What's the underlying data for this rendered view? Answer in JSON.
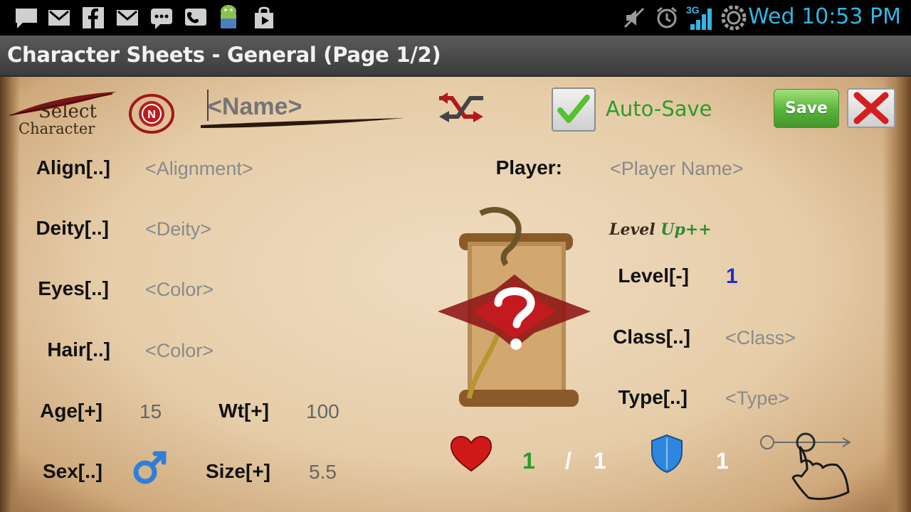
{
  "status_bar": {
    "time": "Wed 10:53 PM",
    "network": "3G",
    "left_icons": [
      "message-icon",
      "gmail-icon",
      "facebook-icon",
      "gmail-icon",
      "chat-icon",
      "voicemail-icon",
      "android-icon",
      "play-store-icon"
    ],
    "right_icons": [
      "mute-icon",
      "alarm-icon",
      "signal-icon",
      "sync-icon"
    ]
  },
  "app": {
    "title": "Character Sheets - General (Page 1/2)"
  },
  "header": {
    "select_line1": "Select",
    "select_line2": "Character",
    "badge": "N",
    "name_placeholder": "<Name>",
    "autosave_label": "Auto-Save",
    "autosave_checked": true,
    "save_label": "Save"
  },
  "fields": {
    "align_label": "Align[..]",
    "align_value": "<Alignment>",
    "deity_label": "Deity[..]",
    "deity_value": "<Deity>",
    "eyes_label": "Eyes[..]",
    "eyes_value": "<Color>",
    "hair_label": "Hair[..]",
    "hair_value": "<Color>",
    "age_label": "Age[+]",
    "age_value": "15",
    "wt_label": "Wt[+]",
    "wt_value": "100",
    "sex_label": "Sex[..]",
    "size_label": "Size[+]",
    "size_value": "5.5",
    "player_label": "Player:",
    "player_value": "<Player Name>",
    "levelup_a": "Level",
    "levelup_b": "Up++",
    "level_label": "Level[-]",
    "level_value": "1",
    "class_label": "Class[..]",
    "class_value": "<Class>",
    "type_label": "Type[..]",
    "type_value": "<Type>"
  },
  "stats": {
    "hp_current": "1",
    "hp_sep": "/",
    "hp_max": "1",
    "ac": "1"
  },
  "colors": {
    "accent": "#33b5e5",
    "green": "#2c9a2c",
    "level_blue": "#1a2fd6"
  }
}
